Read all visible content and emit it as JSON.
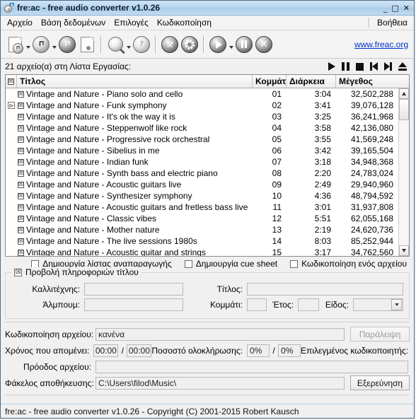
{
  "window": {
    "title": "fre:ac - free audio converter v1.0.26",
    "minimize": "_",
    "maximize": "□",
    "close": "✕"
  },
  "menu": {
    "items": [
      "Αρχείο",
      "Βάση δεδομένων",
      "Επιλογές",
      "Κωδικοποίηση"
    ],
    "help": "Βοήθεια"
  },
  "toolbar": {
    "link": "www.freac.org",
    "buttons": [
      "add-audio-file-icon",
      "add-audio-file-dropdown",
      "add-cd-track-icon",
      "add-cd-track-dropdown",
      "remove-track-icon",
      "clear-joblist-icon",
      "lookup-cddb-icon",
      "lookup-cddb-dropdown",
      "query-cddb-icon",
      "configure-encoder-icon",
      "general-settings-icon",
      "start-encoding-icon",
      "start-encoding-dropdown",
      "pause-encoding-icon",
      "stop-encoding-icon"
    ]
  },
  "joblist": {
    "count_label": "21 αρχείο(α) στη Λίστα Εργασίας:",
    "media_buttons": [
      "play-icon",
      "pause-icon",
      "stop-icon",
      "previous-icon",
      "next-icon",
      "eject-icon"
    ],
    "columns": {
      "corner": "☒",
      "title": "Τίτλος",
      "track": "Κομμάτι",
      "length": "Διάρκεια",
      "size": "Μέγεθος"
    },
    "rows": [
      {
        "mark": "☒",
        "title": "Vintage and Nature - Piano solo and cello",
        "track": "01",
        "length": "3:04",
        "size": "32,502,288"
      },
      {
        "mark": "☒",
        "title": "Vintage and Nature - Funk symphony",
        "track": "02",
        "length": "3:41",
        "size": "39,076,128"
      },
      {
        "mark": "☒",
        "title": "Vintage and Nature - It's ok the way it is",
        "track": "03",
        "length": "3:25",
        "size": "36,241,968"
      },
      {
        "mark": "☒",
        "title": "Vintage and Nature - Steppenwolf like rock",
        "track": "04",
        "length": "3:58",
        "size": "42,136,080"
      },
      {
        "mark": "☒",
        "title": "Vintage and Nature - Progressive rock orchestral",
        "track": "05",
        "length": "3:55",
        "size": "41,569,248"
      },
      {
        "mark": "☒",
        "title": "Vintage and Nature - Sibelius in me",
        "track": "06",
        "length": "3:42",
        "size": "39,165,504"
      },
      {
        "mark": "☒",
        "title": "Vintage and Nature - Indian funk",
        "track": "07",
        "length": "3:18",
        "size": "34,948,368"
      },
      {
        "mark": "☒",
        "title": "Vintage and Nature - Synth bass and electric piano",
        "track": "08",
        "length": "2:20",
        "size": "24,783,024"
      },
      {
        "mark": "☒",
        "title": "Vintage and Nature - Acoustic guitars live",
        "track": "09",
        "length": "2:49",
        "size": "29,940,960"
      },
      {
        "mark": "☒",
        "title": "Vintage and Nature - Synthesizer symphony",
        "track": "10",
        "length": "4:36",
        "size": "48,794,592"
      },
      {
        "mark": "☒",
        "title": "Vintage and Nature - Acoustic guitars and fretless bass live",
        "track": "11",
        "length": "3:01",
        "size": "31,937,808"
      },
      {
        "mark": "☒",
        "title": "Vintage and Nature - Classic vibes",
        "track": "12",
        "length": "5:51",
        "size": "62,055,168"
      },
      {
        "mark": "☒",
        "title": "Vintage and Nature - Mother nature",
        "track": "13",
        "length": "2:19",
        "size": "24,620,736"
      },
      {
        "mark": "☒",
        "title": "Vintage and Nature - The live sessions 1980s",
        "track": "14",
        "length": "8:03",
        "size": "85,252,944"
      },
      {
        "mark": "☒",
        "title": "Vintage and Nature - Acoustic guitar and strings",
        "track": "15",
        "length": "3:17",
        "size": "34,762,560"
      }
    ],
    "gutter_mark": "⊳"
  },
  "options": {
    "create_playlist": {
      "label": "Δημιουργία λίστας αναπαραγωγής",
      "checked": ""
    },
    "create_cue": {
      "label": "Δημιουργία cue sheet",
      "checked": ""
    },
    "single_file": {
      "label": "Κωδικοποίηση ενός αρχείου",
      "checked": ""
    }
  },
  "title_info": {
    "legend": "Προβολή πληροφοριών τίτλου",
    "legend_checked": "☒",
    "artist_label": "Καλλιτέχνης:",
    "artist_value": "",
    "title_label": "Τίτλος:",
    "title_value": "",
    "album_label": "Άλμπουμ:",
    "album_value": "",
    "track_label": "Κομμάτι:",
    "track_value": "",
    "year_label": "Έτος:",
    "year_value": "",
    "genre_label": "Είδος:",
    "genre_value": ""
  },
  "encoder": {
    "file_label": "Κωδικοποίηση αρχείου:",
    "file_value": "κανένα",
    "skip_button": "Παράλειψη",
    "time_label": "Χρόνος που απομένει:",
    "time_current": "00:00",
    "time_sep": "/",
    "time_total": "00:00",
    "percent_label": "Ποσοστό ολοκλήρωσης:",
    "percent_current": "0%",
    "percent_sep": "/",
    "percent_total": "0%",
    "selected_encoder_label": "Επιλεγμένος κωδικοποιητής:",
    "progress_label": "Πρόοδος αρχείου:",
    "progress_value": ""
  },
  "output": {
    "folder_label": "Φάκελος αποθήκευσης:",
    "folder_value": "C:\\Users\\filod\\Music\\",
    "browse_button": "Εξερεύνηση"
  },
  "statusbar": {
    "text": "fre:ac - free audio converter v1.0.26 - Copyright (C) 2001-2015 Robert Kausch"
  },
  "colors": {
    "titlebar": "#bcd8ef",
    "link": "#0033cc",
    "window_border": "#4a6b8a",
    "face": "#f0f0f0"
  }
}
